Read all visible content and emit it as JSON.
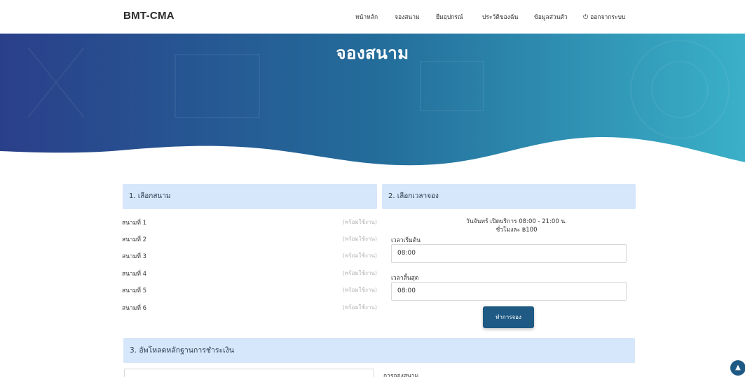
{
  "header": {
    "brand": "BMT-CMA",
    "nav": [
      {
        "label": "หน้าหลัก"
      },
      {
        "label": "จองสนาม"
      },
      {
        "label": "ยืมอุปกรณ์"
      },
      {
        "label": "ประวัติของฉัน"
      },
      {
        "label": "ข้อมูลส่วนตัว"
      },
      {
        "label": "ออกจากระบบ",
        "icon": "power-icon"
      }
    ]
  },
  "hero": {
    "title": "จองสนาม",
    "colors": {
      "left": "#2a3f8a",
      "right": "#3ab0c8"
    }
  },
  "section1": {
    "title": "1. เลือกสนาม",
    "fields": [
      {
        "name": "สนามที่ 1",
        "status": "(พร้อมใช้งาน)"
      },
      {
        "name": "สนามที่ 2",
        "status": "(พร้อมใช้งาน)"
      },
      {
        "name": "สนามที่ 3",
        "status": "(พร้อมใช้งาน)"
      },
      {
        "name": "สนามที่ 4",
        "status": "(พร้อมใช้งาน)"
      },
      {
        "name": "สนามที่ 5",
        "status": "(พร้อมใช้งาน)"
      },
      {
        "name": "สนามที่ 6",
        "status": "(พร้อมใช้งาน)"
      }
    ]
  },
  "section2": {
    "title": "2. เลือกเวลาจอง",
    "hours_line": "วันจันทร์ เปิดบริการ 08:00 - 21:00 น.",
    "price_line": "ชั่วโมงละ ฿100",
    "start_label": "เวลาเริ่มต้น",
    "start_value": "08:00",
    "end_label": "เวลาสิ้นสุด",
    "end_value": "08:00",
    "book_button": "ทำการจอง"
  },
  "section3": {
    "title": "3. อัพโหลดหลักฐานการชำระเงิน",
    "summary_label": "การจองสนาม"
  },
  "scroll_top_icon": "chevron-up-icon",
  "accent": "#1f5a84",
  "panel_bg": "#d6e6fb"
}
